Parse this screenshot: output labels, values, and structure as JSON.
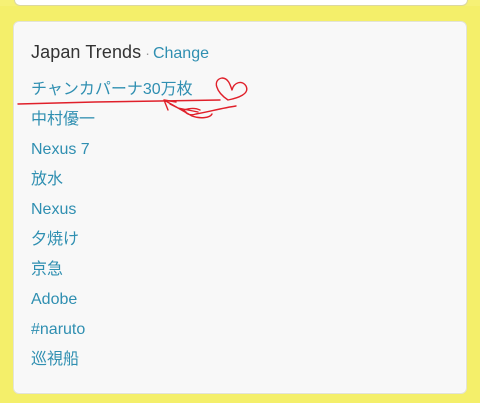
{
  "trends": {
    "title": "Japan Trends",
    "separator": "·",
    "change_label": "Change",
    "items": [
      {
        "label": "チャンカパーナ30万枚"
      },
      {
        "label": "中村優一"
      },
      {
        "label": "Nexus 7"
      },
      {
        "label": "放水"
      },
      {
        "label": "Nexus"
      },
      {
        "label": "夕焼け"
      },
      {
        "label": "京急"
      },
      {
        "label": "Adobe"
      },
      {
        "label": "#naruto"
      },
      {
        "label": "巡視船"
      }
    ]
  },
  "annotation": {
    "ink_color": "#e0202a",
    "shapes": [
      "underline",
      "arrow",
      "heart"
    ]
  }
}
